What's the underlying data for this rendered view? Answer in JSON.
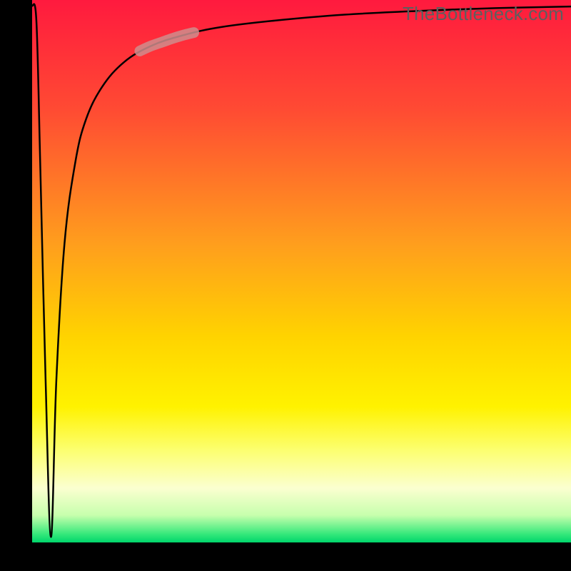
{
  "watermark": "TheBottleneck.com",
  "chart_data": {
    "type": "line",
    "title": "",
    "xlabel": "",
    "ylabel": "",
    "xlim": [
      0,
      100
    ],
    "ylim": [
      0,
      100
    ],
    "grid": false,
    "legend": false,
    "background_gradient": {
      "orientation": "vertical",
      "stops": [
        {
          "pos": 0.0,
          "color": "#ff1a3e"
        },
        {
          "pos": 0.2,
          "color": "#ff4a33"
        },
        {
          "pos": 0.45,
          "color": "#ff9e1d"
        },
        {
          "pos": 0.62,
          "color": "#ffd300"
        },
        {
          "pos": 0.75,
          "color": "#fff200"
        },
        {
          "pos": 0.83,
          "color": "#fcff70"
        },
        {
          "pos": 0.9,
          "color": "#fbffd0"
        },
        {
          "pos": 0.95,
          "color": "#c7ffad"
        },
        {
          "pos": 0.985,
          "color": "#34e87a"
        },
        {
          "pos": 1.0,
          "color": "#00d56b"
        }
      ]
    },
    "series": [
      {
        "name": "bottleneck-curve",
        "stroke": "#000000",
        "stroke_width": 2.5,
        "x": [
          0.0,
          0.8,
          1.5,
          2.5,
          3.5,
          4.5,
          6.0,
          8.0,
          10.0,
          13.0,
          17.0,
          22.0,
          28.0,
          35.0,
          45.0,
          58.0,
          72.0,
          86.0,
          100.0
        ],
        "values": [
          99.0,
          96.0,
          70.0,
          30.0,
          1.0,
          30.0,
          55.0,
          70.0,
          78.0,
          84.0,
          88.5,
          91.5,
          93.5,
          95.0,
          96.2,
          97.3,
          98.0,
          98.5,
          98.8
        ]
      }
    ],
    "highlight_segment": {
      "note": "thick translucent pink segment lying on the curve near the upper-left bend",
      "stroke": "#cf8d8d",
      "stroke_width": 15,
      "opacity": 0.85,
      "x": [
        20.0,
        22.0,
        24.0,
        26.0,
        28.0,
        30.0
      ],
      "values": [
        90.6,
        91.5,
        92.2,
        92.9,
        93.5,
        94.0
      ]
    }
  }
}
